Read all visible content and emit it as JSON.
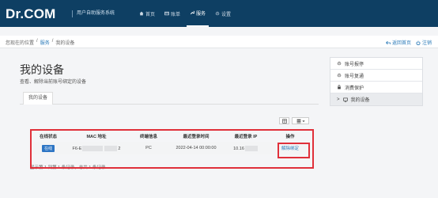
{
  "header": {
    "brand": "Dr.COM",
    "subtitle": "用户自助服务系统",
    "nav": [
      {
        "label": "首页",
        "icon": "home-icon"
      },
      {
        "label": "账单",
        "icon": "bill-icon"
      },
      {
        "label": "服务",
        "icon": "wrench-icon",
        "active": true
      },
      {
        "label": "设置",
        "icon": "gear-icon"
      }
    ]
  },
  "breadcrumb": {
    "prefix": "您现在的位置",
    "sep": "/",
    "level1": "服务",
    "current": "我的设备"
  },
  "quicklinks": {
    "back": "返回首页",
    "logout": "注销"
  },
  "page": {
    "title": "我的设备",
    "description": "查看、解除当前账号绑定的设备",
    "tab": "我的设备"
  },
  "table": {
    "columns": [
      "在线状态",
      "MAC 地址",
      "终端信息",
      "最近登录时间",
      "最近登录 IP",
      "操作"
    ],
    "rows": [
      {
        "status": "在线",
        "mac_prefix": "F6-E",
        "mac_suffix": "2",
        "terminal": "PC",
        "last_login": "2022-04-14 00:00:00",
        "ip_prefix": "10.16",
        "action": "解除绑定"
      }
    ]
  },
  "pager": "显示第 1 到第 1 条记录，总共 1 条记录",
  "sidebar": {
    "items": [
      {
        "label": "账号报停",
        "icon": "gear-icon"
      },
      {
        "label": "账号复通",
        "icon": "gear-icon"
      },
      {
        "label": "消费保护",
        "icon": "lock-icon"
      },
      {
        "label": "我的设备",
        "icon": "monitor-icon",
        "prefix": ">",
        "active": true
      }
    ]
  },
  "footer": {
    "links": [
      "",
      "",
      "",
      ""
    ]
  },
  "colors": {
    "topbar": "#0e3f63",
    "accent": "#2a7ab8",
    "highlight_box": "#e0303a",
    "badge": "#2d75c4"
  }
}
